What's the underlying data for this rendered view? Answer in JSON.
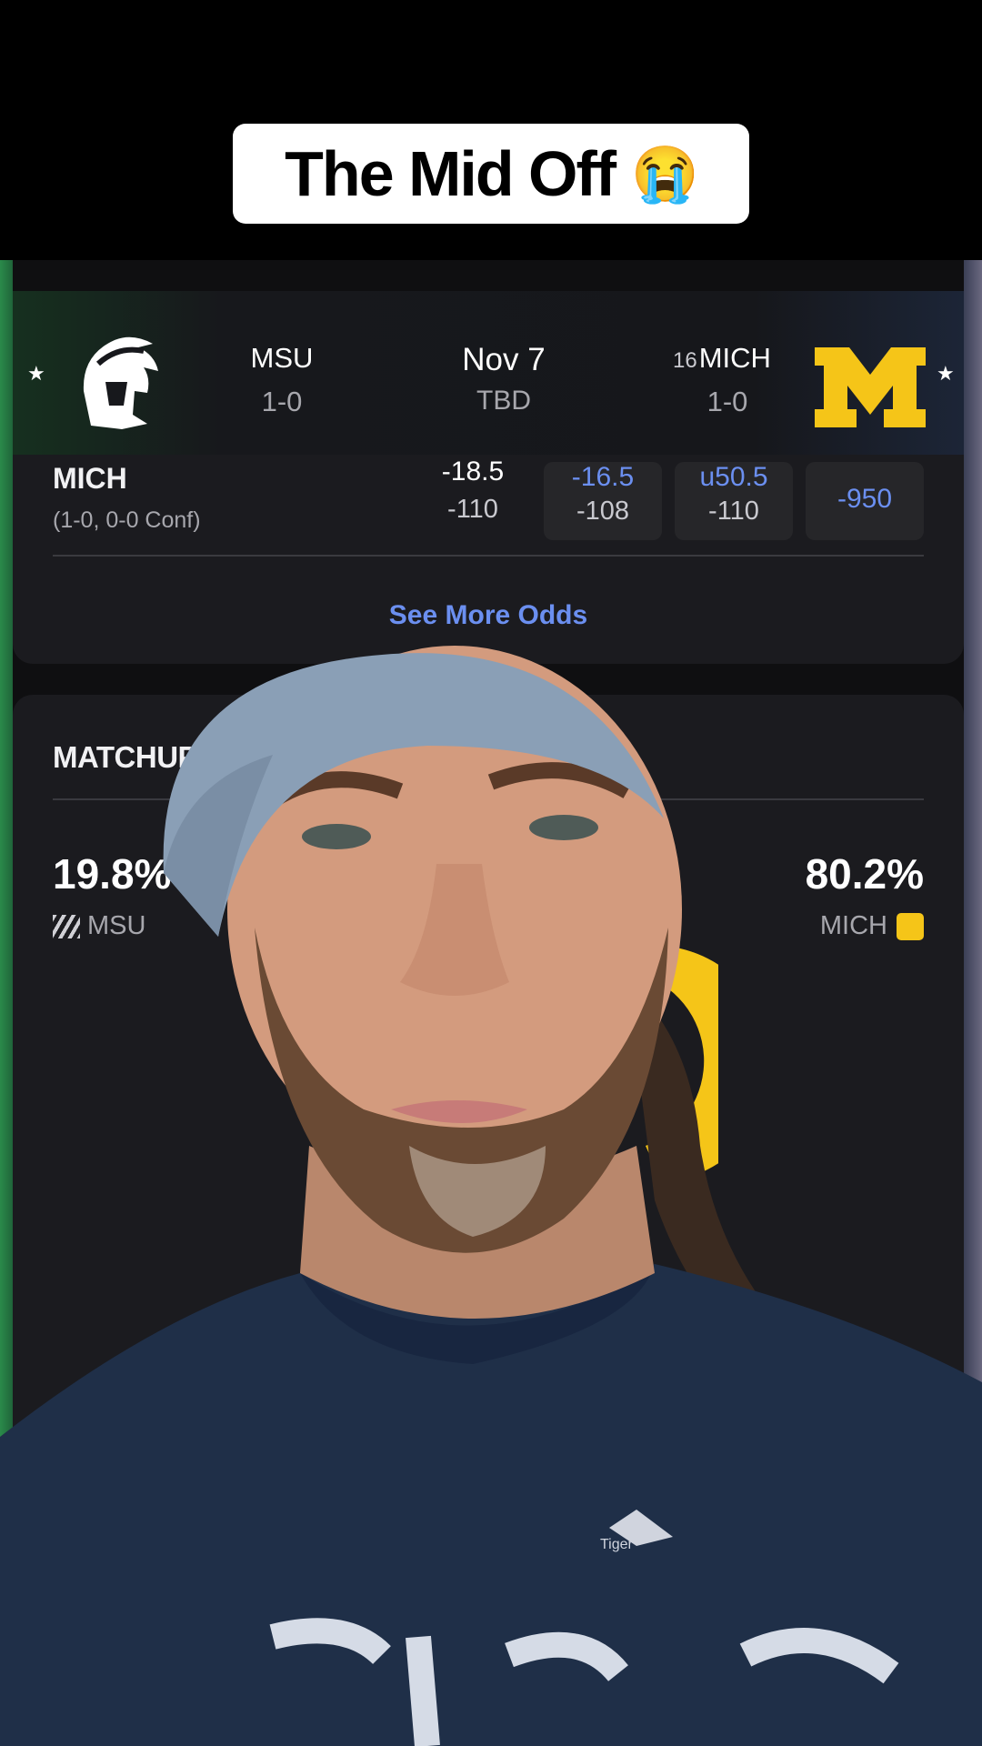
{
  "caption": {
    "text": "The Mid Off",
    "emoji": "😭"
  },
  "header": {
    "away": {
      "name": "MSU",
      "record": "1-0"
    },
    "home": {
      "rank": "16",
      "name": "MICH",
      "record": "1-0"
    },
    "date": "Nov 7",
    "time": "TBD",
    "star": "★"
  },
  "odds": {
    "team": "MICH",
    "record": "(1-0, 0-0 Conf)",
    "open": {
      "line": "-18.5",
      "price": "-110"
    },
    "spread": {
      "line": "-16.5",
      "price": "-108"
    },
    "total": {
      "line": "u50.5",
      "price": "-110"
    },
    "moneyline": "-950",
    "see_more": "See More Odds"
  },
  "predictor": {
    "title": "MATCHUP P",
    "away": {
      "pct": "19.8%",
      "label": "MSU"
    },
    "home": {
      "pct": "80.2%",
      "label": "MICH"
    }
  },
  "colors": {
    "mich_maize": "#f5c518",
    "link_blue": "#6b8ff0",
    "card_bg": "#1b1b1f"
  },
  "shirt_logo_text": "Tiger"
}
